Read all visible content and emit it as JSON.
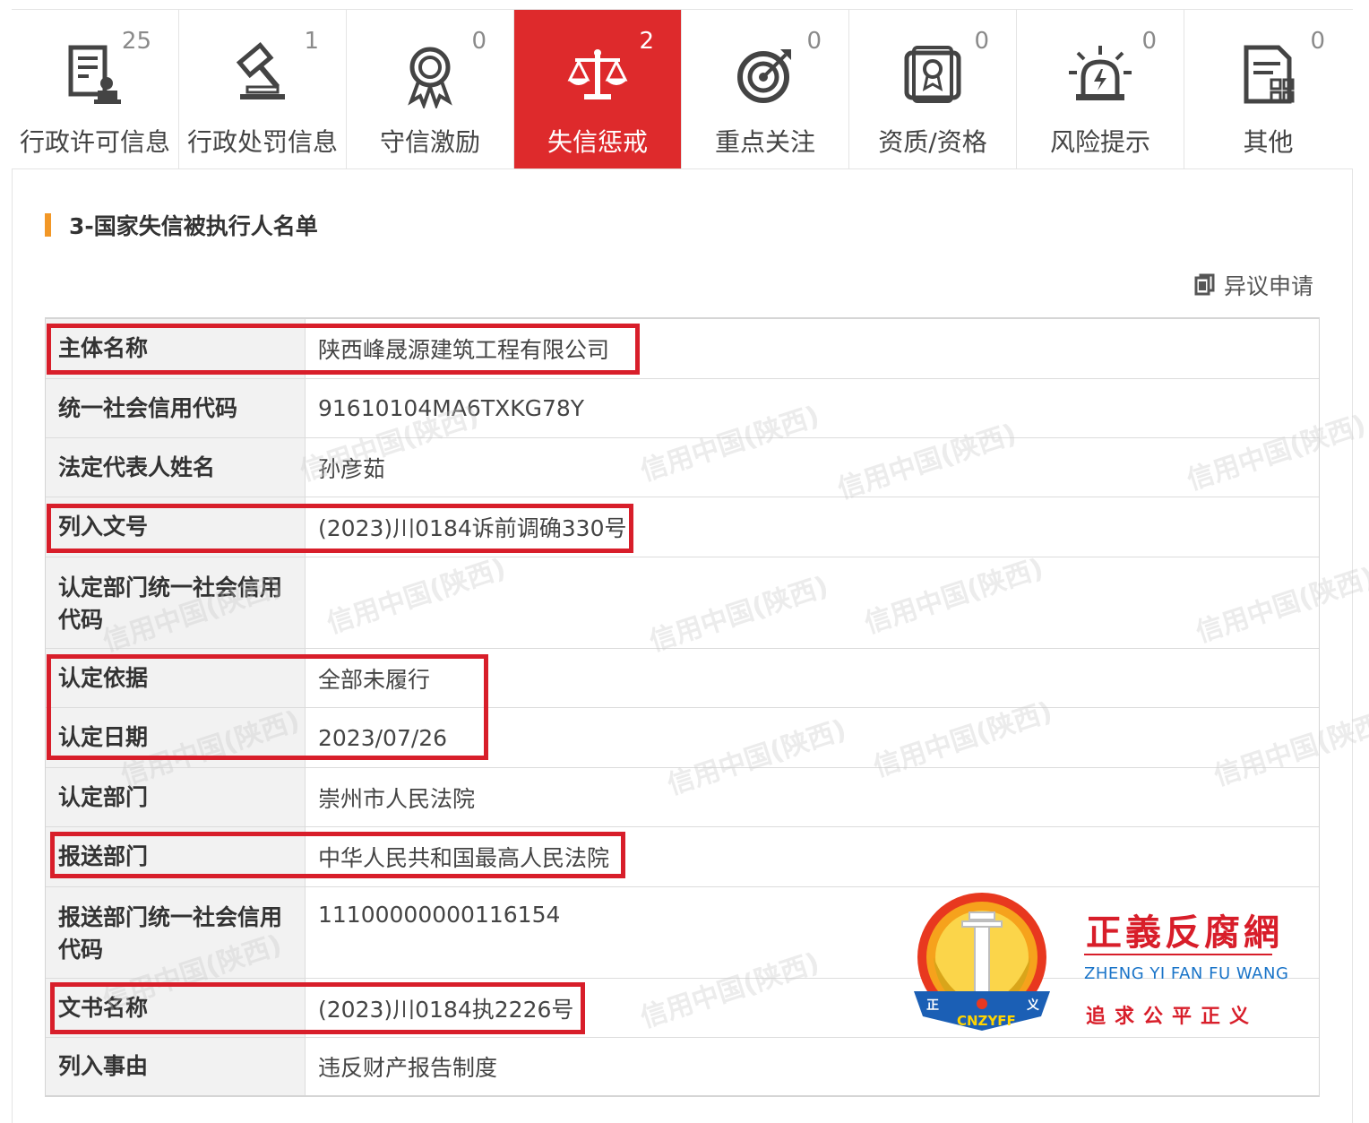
{
  "tabs": [
    {
      "label": "行政许可信息",
      "count": "25",
      "icon": "license-document-icon"
    },
    {
      "label": "行政处罚信息",
      "count": "1",
      "icon": "gavel-icon"
    },
    {
      "label": "守信激励",
      "count": "0",
      "icon": "award-ribbon-icon"
    },
    {
      "label": "失信惩戒",
      "count": "2",
      "icon": "scales-icon",
      "active": true
    },
    {
      "label": "重点关注",
      "count": "0",
      "icon": "target-icon"
    },
    {
      "label": "资质/资格",
      "count": "0",
      "icon": "certificate-icon"
    },
    {
      "label": "风险提示",
      "count": "0",
      "icon": "alarm-light-icon"
    },
    {
      "label": "其他",
      "count": "0",
      "icon": "other-document-icon"
    }
  ],
  "section": {
    "title": "3-国家失信被执行人名单",
    "objection_label": "异议申请"
  },
  "rows": [
    {
      "key": "主体名称",
      "value": "陕西峰晟源建筑工程有限公司"
    },
    {
      "key": "统一社会信用代码",
      "value": "91610104MA6TXKG78Y"
    },
    {
      "key": "法定代表人姓名",
      "value": "孙彦茹"
    },
    {
      "key": "列入文号",
      "value": "(2023)川0184诉前调确330号"
    },
    {
      "key": "认定部门统一社会信用代码",
      "value": ""
    },
    {
      "key": "认定依据",
      "value": "全部未履行"
    },
    {
      "key": "认定日期",
      "value": "2023/07/26"
    },
    {
      "key": "认定部门",
      "value": "崇州市人民法院"
    },
    {
      "key": "报送部门",
      "value": "中华人民共和国最高人民法院"
    },
    {
      "key": "报送部门统一社会信用代码",
      "value": "11100000000116154"
    },
    {
      "key": "文书名称",
      "value": "(2023)川0184执2226号"
    },
    {
      "key": "列入事由",
      "value": "违反财产报告制度"
    }
  ],
  "watermark_text": "信用中国(陕西)",
  "logo": {
    "name_cn": "正義反腐網",
    "name_en": "ZHENG YI FAN FU WANG",
    "slogan": "追求公平正义",
    "emblem_text": "CNZYFF",
    "emblem_left_char": "正",
    "emblem_right_char": "义"
  },
  "colors": {
    "active_tab": "#de2a2c",
    "section_accent": "#f29726",
    "highlight_box": "#d81e2a",
    "logo_red": "#d81e2a",
    "logo_blue": "#1a74c8"
  }
}
